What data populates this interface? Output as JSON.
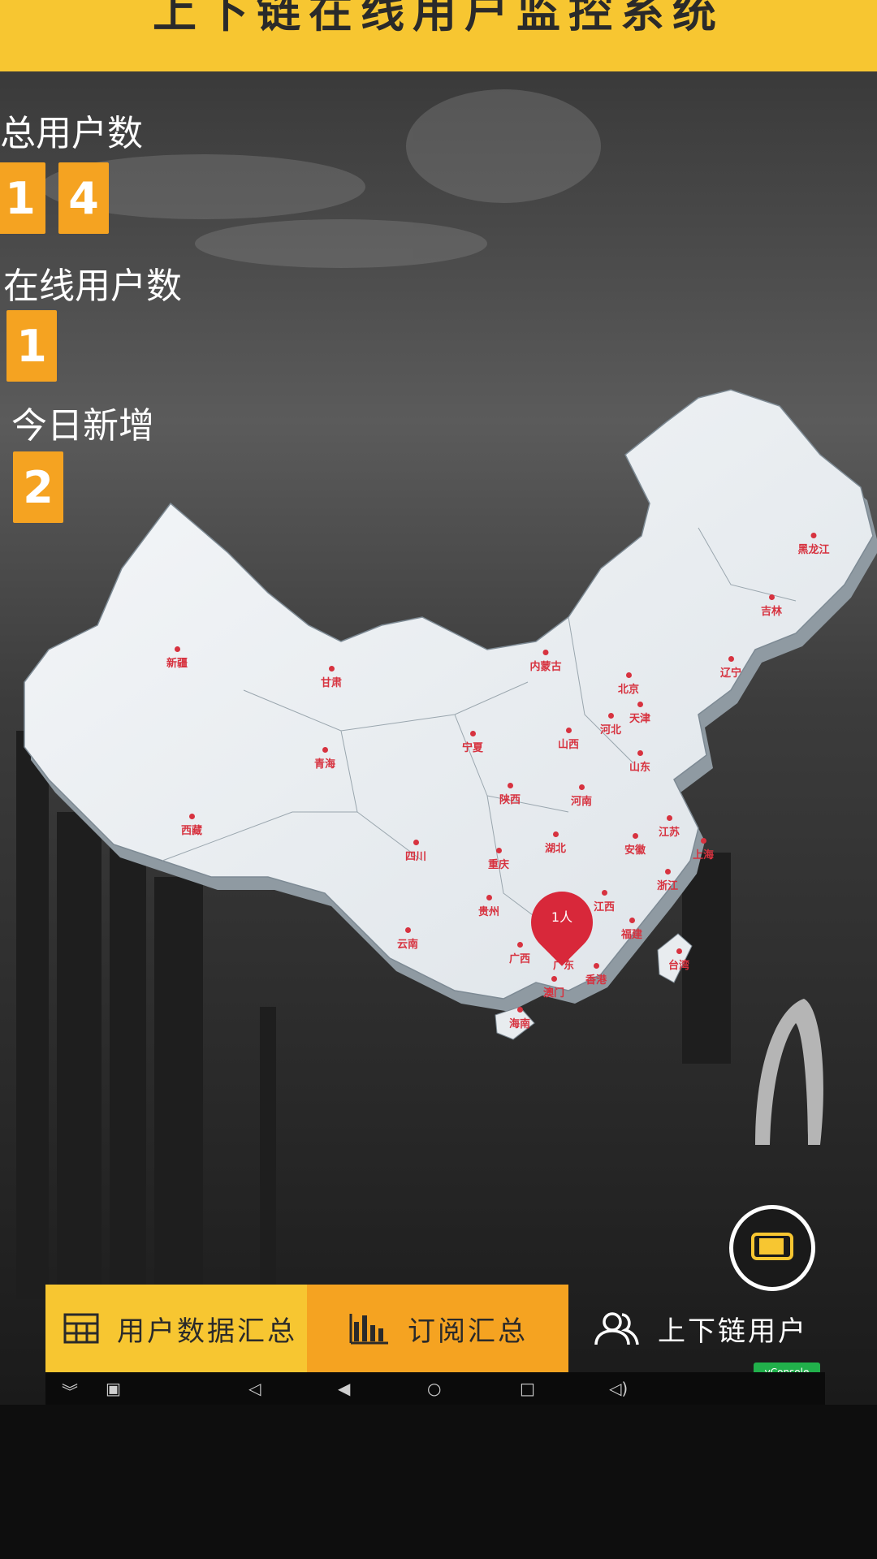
{
  "header": {
    "title": "上下链在线用户监控系统"
  },
  "stats": {
    "total_users": {
      "label": "总用户数",
      "digits": [
        "1",
        "4"
      ]
    },
    "online_users": {
      "label": "在线用户数",
      "digits": [
        "1"
      ]
    },
    "today_new": {
      "label": "今日新增",
      "digits": [
        "2"
      ]
    }
  },
  "map": {
    "provinces": [
      "新疆",
      "甘肃",
      "内蒙古",
      "黑龙江",
      "吉林",
      "辽宁",
      "北京",
      "天津",
      "河北",
      "宁夏",
      "山西",
      "山东",
      "青海",
      "陕西",
      "河南",
      "西藏",
      "江苏",
      "四川",
      "湖北",
      "安徽",
      "上海",
      "重庆",
      "浙江",
      "贵州",
      "江西",
      "云南",
      "福建",
      "广西",
      "广东",
      "台湾",
      "澳门",
      "香港",
      "海南"
    ],
    "marker": {
      "label": "1人",
      "province": "广东"
    }
  },
  "nav": {
    "user_data": "用户数据汇总",
    "subscription": "订阅汇总",
    "chain_users": "上下链用户"
  },
  "vconsole": "vConsole",
  "icons": {
    "device": "phone-landscape-icon",
    "table": "table-icon",
    "bar_chart": "bar-chart-icon",
    "users": "users-icon"
  },
  "colors": {
    "header": "#f7c631",
    "accent": "#f5a321",
    "marker": "#d8283a",
    "vconsole": "#21b04b"
  }
}
